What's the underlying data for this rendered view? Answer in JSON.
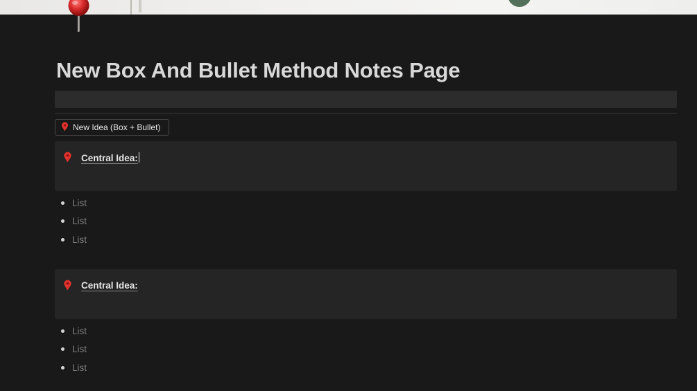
{
  "page": {
    "title": "New Box And Bullet Method Notes Page",
    "icon": "pushpin-icon"
  },
  "template_button": {
    "label": "New Idea (Box + Bullet)",
    "icon": "round-pushpin-icon"
  },
  "blocks": [
    {
      "callout": {
        "icon": "round-pushpin-icon",
        "text": "Central Idea:"
      },
      "items": [
        "List",
        "List",
        "List"
      ]
    },
    {
      "callout": {
        "icon": "round-pushpin-icon",
        "text": "Central Idea:"
      },
      "items": [
        "List",
        "List",
        "List"
      ]
    }
  ],
  "colors": {
    "background": "#191919",
    "callout_bg": "#252525",
    "pin_red": "#d92b2b"
  }
}
